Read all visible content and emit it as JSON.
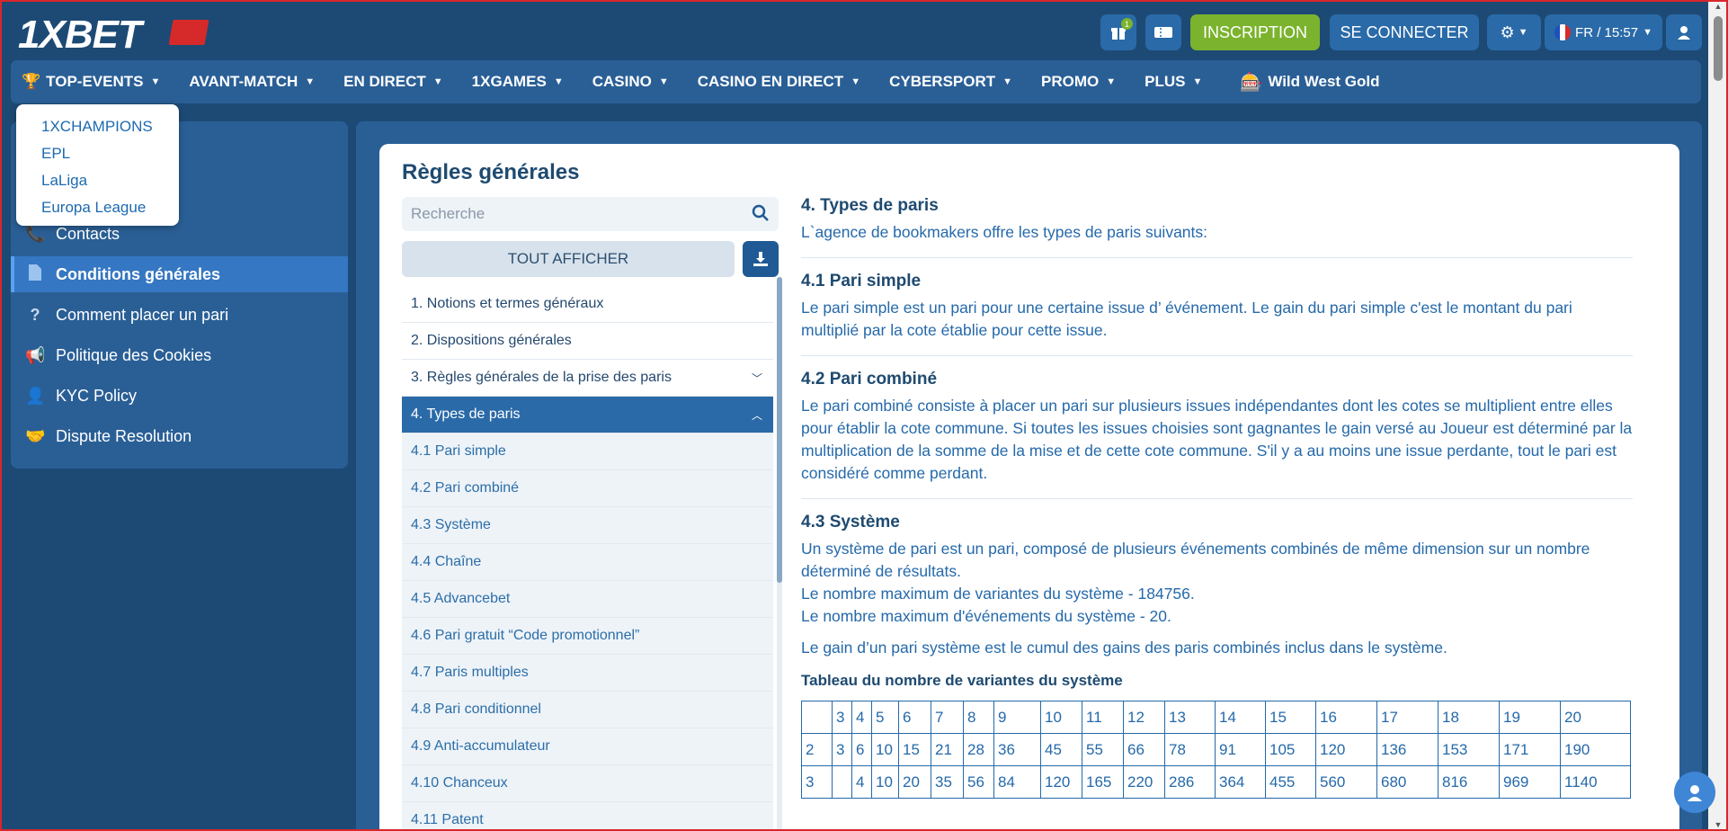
{
  "header": {
    "logo": "1XBET",
    "gift_badge": "1",
    "inscription": "INSCRIPTION",
    "connect": "SE CONNECTER",
    "lang_time": "FR / 15:57"
  },
  "nav": {
    "items": [
      {
        "label": "TOP-EVENTS"
      },
      {
        "label": "AVANT-MATCH"
      },
      {
        "label": "EN DIRECT"
      },
      {
        "label": "1XGAMES"
      },
      {
        "label": "CASINO"
      },
      {
        "label": "CASINO EN DIRECT"
      },
      {
        "label": "CYBERSPORT"
      },
      {
        "label": "PROMO"
      },
      {
        "label": "PLUS"
      }
    ],
    "promo_game": "Wild West Gold"
  },
  "dropdown": {
    "items": [
      "1XCHAMPIONS",
      "EPL",
      "LaLiga",
      "Europa League"
    ]
  },
  "sidebar": {
    "items": [
      {
        "label": "Contacts",
        "icon": "phone-icon"
      },
      {
        "label": "Conditions générales",
        "icon": "document-icon"
      },
      {
        "label": "Comment placer un pari",
        "icon": "question-icon"
      },
      {
        "label": "Politique des Cookies",
        "icon": "megaphone-icon"
      },
      {
        "label": "KYC Policy",
        "icon": "user-check-icon"
      },
      {
        "label": "Dispute Resolution",
        "icon": "handshake-icon"
      }
    ]
  },
  "main": {
    "title": "Règles générales",
    "search_placeholder": "Recherche",
    "show_all": "TOUT AFFICHER",
    "toc": [
      "1. Notions et termes généraux",
      "2. Dispositions générales",
      "3. Règles générales de la prise des paris",
      "4. Types de paris",
      "4.1 Pari simple",
      "4.2 Pari combiné",
      "4.3 Système",
      "4.4 Chaîne",
      "4.5 Advancebet",
      "4.6 Pari gratuit “Code promotionnel”",
      "4.7 Paris multiples",
      "4.8 Pari conditionnel",
      "4.9 Anti-accumulateur",
      "4.10 Chanceux",
      "4.11 Patent"
    ]
  },
  "doc": {
    "h_types": "4. Types de paris",
    "p_types": "L`agence de bookmakers offre les types de paris suivants:",
    "h_simple": "4.1 Pari simple",
    "p_simple": "Le pari simple est un pari pour une certaine issue d’ événement. Le gain du pari simple c'est le montant du pari multiplié par la cote établie pour cette issue.",
    "h_combine": "4.2 Pari combiné",
    "p_combine": "Le pari combiné consiste à placer un pari sur plusieurs issues indépendantes dont les cotes se multiplient entre elles pour établir la cote commune. Si toutes les issues choisies sont gagnantes le gain versé au Joueur est déterminé par la multiplication de la somme de la mise et de cette cote commune. S'il y a au moins une issue perdante, tout le pari est considéré comme perdant.",
    "h_systeme": "4.3 Système",
    "p_systeme1": "Un système de pari est un pari, composé de plusieurs événements combinés de même dimension sur un nombre déterminé de résultats.",
    "p_systeme2": "Le nombre maximum de variantes du système - 184756.",
    "p_systeme3": "Le nombre maximum d'événements du système - 20.",
    "p_systeme4": "Le gain d’un pari système est le cumul des gains des paris combinés inclus dans le système.",
    "table_title": "Tableau du nombre de variantes du système",
    "table_rows": [
      [
        "",
        "3",
        "4",
        "5",
        "6",
        "7",
        "8",
        "9",
        "10",
        "11",
        "12",
        "13",
        "14",
        "15",
        "16",
        "17",
        "18",
        "19",
        "20"
      ],
      [
        "2",
        "3",
        "6",
        "10",
        "15",
        "21",
        "28",
        "36",
        "45",
        "55",
        "66",
        "78",
        "91",
        "105",
        "120",
        "136",
        "153",
        "171",
        "190"
      ],
      [
        "3",
        "",
        "4",
        "10",
        "20",
        "35",
        "56",
        "84",
        "120",
        "165",
        "220",
        "286",
        "364",
        "455",
        "560",
        "680",
        "816",
        "969",
        "1140"
      ]
    ]
  },
  "colors": {
    "bg": "#1d4a75",
    "accent_green": "#7bb32e",
    "accent_blue": "#2a6aa8",
    "text_link": "#2569aa"
  }
}
